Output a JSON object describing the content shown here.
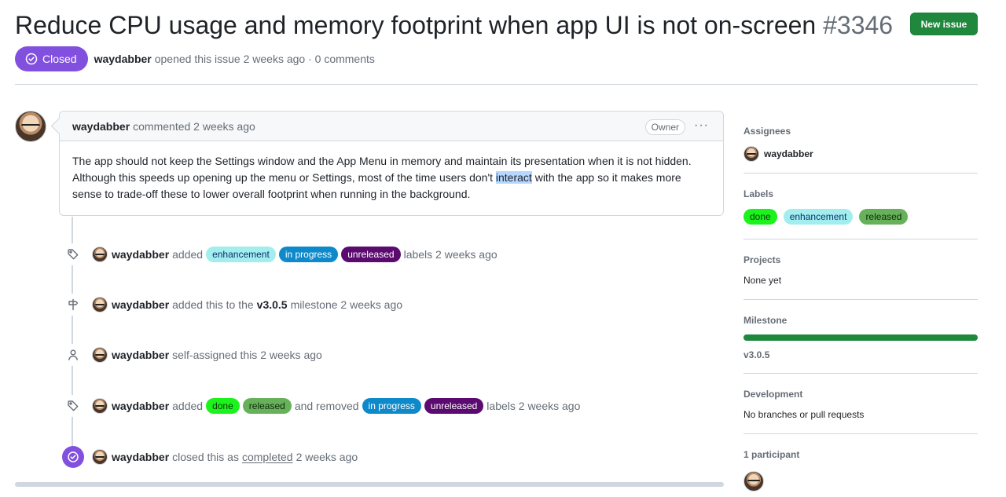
{
  "issue": {
    "title": "Reduce CPU usage and memory footprint when app UI is not on-screen",
    "number": "#3346",
    "state": "Closed",
    "author": "waydabber",
    "opened_text": "opened this issue 2 weeks ago · 0 comments"
  },
  "header": {
    "new_issue_label": "New issue"
  },
  "comment": {
    "author": "waydabber",
    "meta": "commented 2 weeks ago",
    "badge": "Owner",
    "menu": "···",
    "body_1": "The app should not keep the Settings window and the App Menu in memory and maintain its presentation when it is not hidden. Although this speeds up opening up the menu or Settings, most of the time users don't ",
    "body_hl": "interact",
    "body_2": " with the app so it makes more sense to trade-off these to lower overall footprint when running in the background."
  },
  "timeline": {
    "ev1": {
      "actor": "waydabber",
      "verb": "added",
      "labels": [
        "enhancement",
        "in progress",
        "unreleased"
      ],
      "suffix": "labels 2 weeks ago"
    },
    "ev2": {
      "actor": "waydabber",
      "pre": "added this to the",
      "milestone": "v3.0.5",
      "suffix": "milestone 2 weeks ago"
    },
    "ev3": {
      "actor": "waydabber",
      "text": "self-assigned this 2 weeks ago"
    },
    "ev4": {
      "actor": "waydabber",
      "verb": "added",
      "added": [
        "done",
        "released"
      ],
      "mid": "and removed",
      "removed": [
        "in progress",
        "unreleased"
      ],
      "suffix": "labels 2 weeks ago"
    },
    "ev5": {
      "actor": "waydabber",
      "pre": "closed this as",
      "link": "completed",
      "suffix": "2 weeks ago"
    }
  },
  "sidebar": {
    "assignees": {
      "heading": "Assignees",
      "user": "waydabber"
    },
    "labels": {
      "heading": "Labels",
      "items": [
        "done",
        "enhancement",
        "released"
      ]
    },
    "projects": {
      "heading": "Projects",
      "value": "None yet"
    },
    "milestone": {
      "heading": "Milestone",
      "name": "v3.0.5",
      "progress": 1.0
    },
    "development": {
      "heading": "Development",
      "value": "No branches or pull requests"
    },
    "participants": {
      "heading": "1 participant"
    }
  },
  "colors": {
    "closed": "#8250df",
    "primary_button": "#1f883d",
    "label_enhancement": "#a2eeef",
    "label_in_progress": "#0e8acb",
    "label_unreleased": "#5b0a6f",
    "label_done": "#1cf21c",
    "label_released": "#67b15a"
  },
  "icons": {
    "state": "check-circle-icon",
    "tag": "tag-icon",
    "milestone": "milestone-icon",
    "person": "person-icon",
    "closed": "check-circle-fill-icon",
    "menu": "kebab-horizontal-icon"
  }
}
